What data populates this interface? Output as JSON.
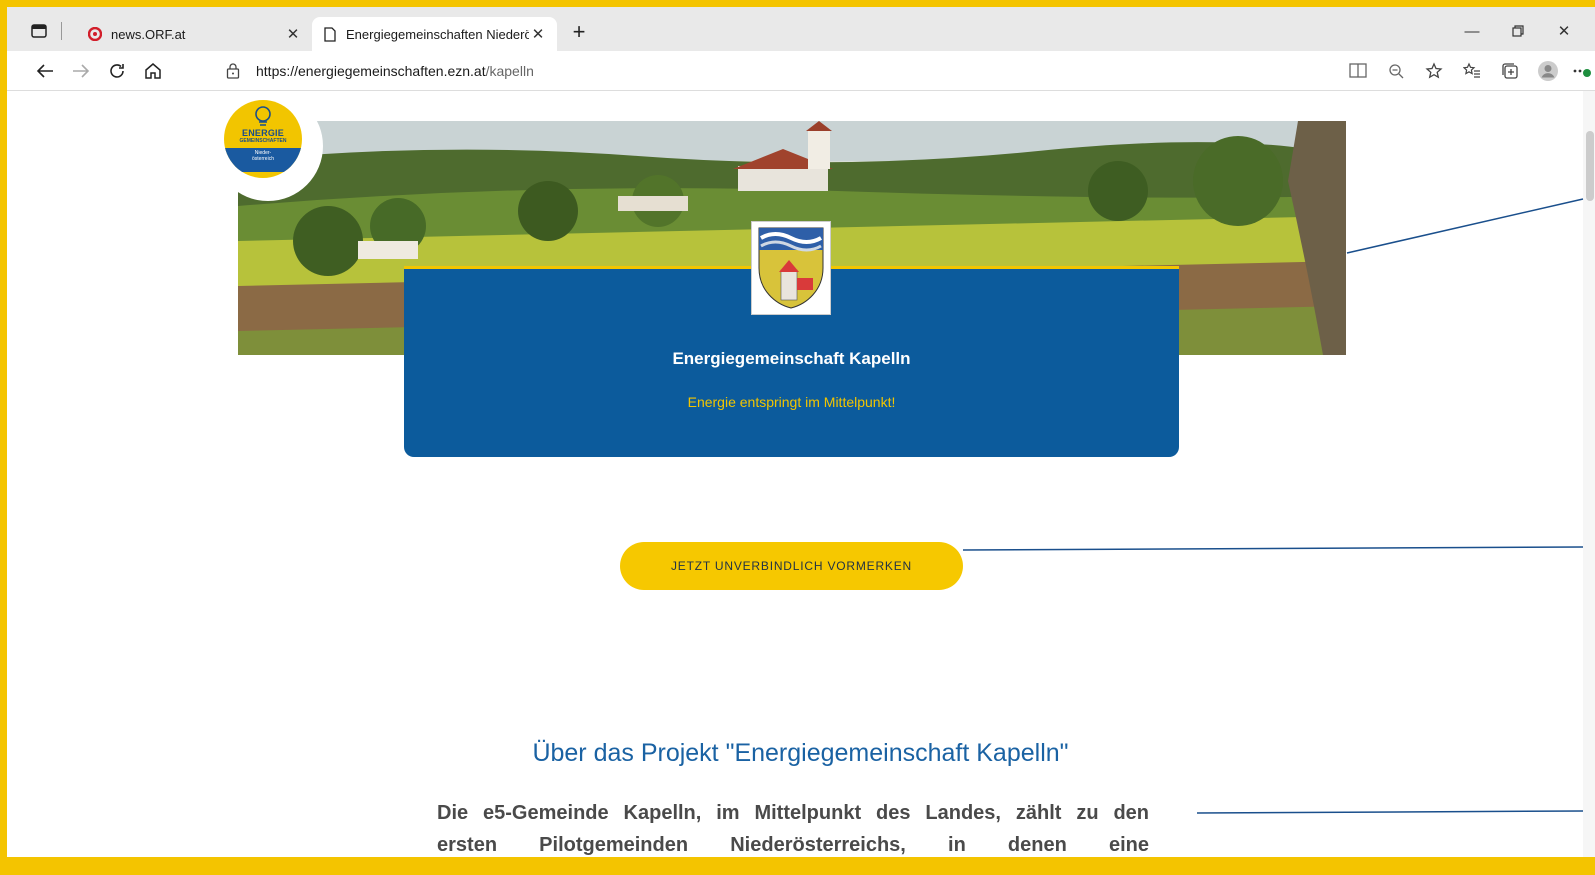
{
  "browser": {
    "tabs": [
      {
        "title": "news.ORF.at",
        "favicon": "orf-icon",
        "active": false
      },
      {
        "title": "Energiegemeinschaften Niederös",
        "favicon": "page-icon",
        "active": true
      }
    ],
    "new_tab_label": "+",
    "url_host": "https://energiegemeinschaften.ezn.at",
    "url_path": "/kapelln",
    "window_controls": [
      "minimize",
      "restore",
      "close"
    ]
  },
  "logo": {
    "line1": "ENERGIE",
    "line2": "GEMEINSCHAFTEN",
    "line3": "Nieder-österreich"
  },
  "hero": {
    "title": "Energiegemeinschaft Kapelln",
    "subtitle": "Energie entspringt im Mittelpunkt!"
  },
  "cta": {
    "label": "JETZT UNVERBINDLICH VORMERKEN"
  },
  "about": {
    "title": "Über das Projekt \"Energiegemeinschaft Kapelln\"",
    "paragraph_line1": "Die e5-Gemeinde Kapelln, im Mittelpunkt des Landes, zählt zu den",
    "paragraph_line2": "ersten Pilotgemeinden Niederösterreichs, in denen eine"
  },
  "colors": {
    "frame": "#f4c400",
    "card": "#0c5b9c",
    "accent_yellow": "#f2c500",
    "title_blue": "#1a62a3"
  }
}
